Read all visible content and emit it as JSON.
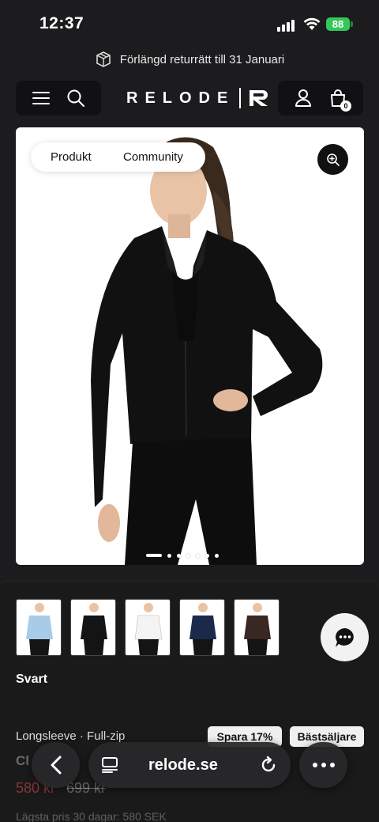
{
  "status": {
    "time": "12:37",
    "battery": "88"
  },
  "announcement": {
    "text": "Förlängd returrätt till 31 Januari",
    "icon": "package-icon"
  },
  "header": {
    "logo": "RELODE",
    "cart_count": "0"
  },
  "gallery": {
    "tabs": [
      "Produkt",
      "Community"
    ],
    "image_count": 7,
    "active_index": 0
  },
  "variants": {
    "swatches": [
      {
        "name": "light-blue",
        "color": "#a8cbe8"
      },
      {
        "name": "black",
        "color": "#141414"
      },
      {
        "name": "white",
        "color": "#f4f4f4"
      },
      {
        "name": "navy",
        "color": "#1b2a4a"
      },
      {
        "name": "brown",
        "color": "#3a2622"
      }
    ],
    "selected_label": "Svart"
  },
  "product": {
    "category": "Longsleeve · Full-zip",
    "badges": [
      "Spara 17%",
      "Bästsäljare"
    ],
    "name_partial": "Cl",
    "price_sale": "580 kr",
    "price_old": "699 kr",
    "lowest_price": "Lägsta pris 30 dagar: 580 SEK"
  },
  "browser": {
    "url": "relode.se"
  },
  "colors": {
    "background": "#1c1c1e",
    "battery": "#34c759"
  }
}
